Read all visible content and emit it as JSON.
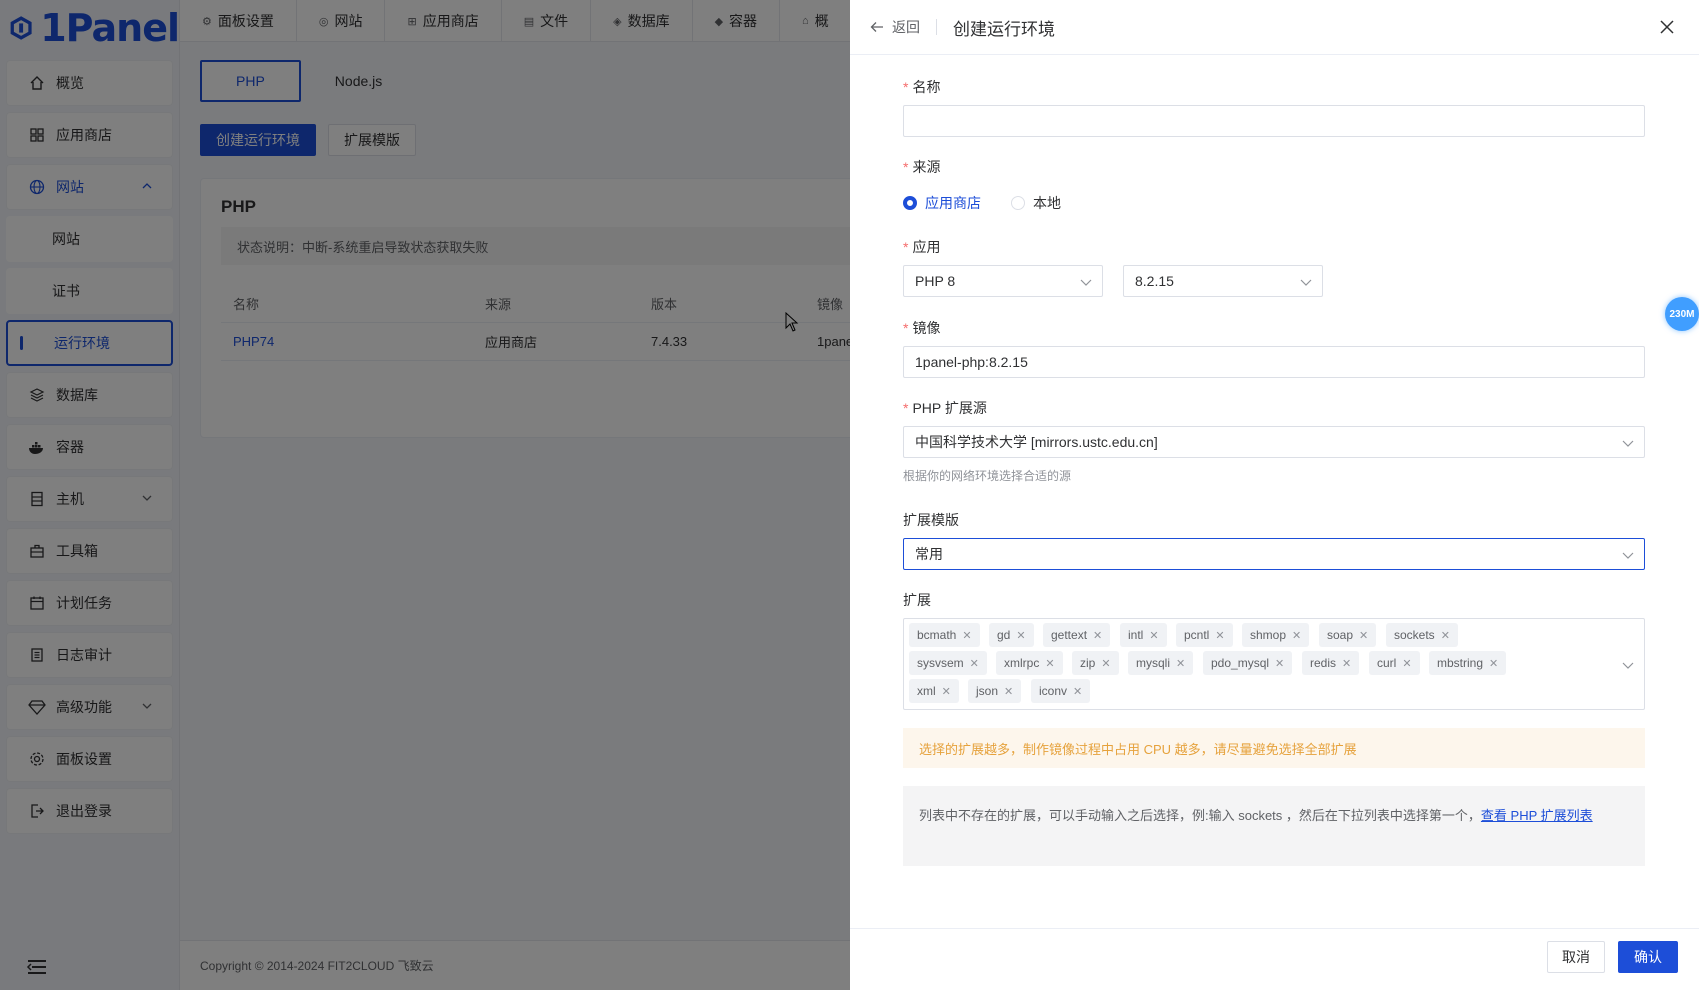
{
  "sidebar": {
    "logo_text": "1Panel",
    "items": [
      {
        "label": "概览",
        "icon": "home-icon"
      },
      {
        "label": "应用商店",
        "icon": "grid-icon"
      },
      {
        "label": "网站",
        "icon": "globe-icon"
      },
      {
        "label": "网站",
        "icon": ""
      },
      {
        "label": "证书",
        "icon": ""
      },
      {
        "label": "运行环境",
        "icon": ""
      },
      {
        "label": "数据库",
        "icon": "layers-icon"
      },
      {
        "label": "容器",
        "icon": "docker-icon"
      },
      {
        "label": "主机",
        "icon": "server-icon"
      },
      {
        "label": "工具箱",
        "icon": "toolbox-icon"
      },
      {
        "label": "计划任务",
        "icon": "calendar-icon"
      },
      {
        "label": "日志审计",
        "icon": "log-icon"
      },
      {
        "label": "高级功能",
        "icon": "diamond-icon"
      },
      {
        "label": "面板设置",
        "icon": "gear-icon"
      },
      {
        "label": "退出登录",
        "icon": "logout-icon"
      }
    ]
  },
  "topbar": {
    "tabs": [
      {
        "label": "面板设置",
        "glyph": "⚙"
      },
      {
        "label": "网站",
        "glyph": "◎"
      },
      {
        "label": "应用商店",
        "glyph": "⊞"
      },
      {
        "label": "文件",
        "glyph": "▤"
      },
      {
        "label": "数据库",
        "glyph": "◈"
      },
      {
        "label": "容器",
        "glyph": "◆"
      },
      {
        "label": "概",
        "glyph": "⌂"
      }
    ]
  },
  "main": {
    "subtabs": [
      "PHP",
      "Node.js"
    ],
    "buttons": {
      "create": "创建运行环境",
      "ext_template": "扩展模版"
    },
    "card_title": "PHP",
    "notice": "状态说明：中断-系统重启导致状态获取失败",
    "columns": [
      "名称",
      "来源",
      "版本",
      "镜像"
    ],
    "rows": [
      {
        "name": "PHP74",
        "source": "应用商店",
        "version": "7.4.33",
        "image": "1pane"
      }
    ],
    "footer": "Copyright © 2014-2024 FIT2CLOUD 飞致云"
  },
  "drawer": {
    "back_label": "返回",
    "title": "创建运行环境",
    "form": {
      "name_label": "名称",
      "name_value": "",
      "source_label": "来源",
      "source_options": [
        "应用商店",
        "本地"
      ],
      "app_label": "应用",
      "app_value": "PHP 8",
      "version_value": "8.2.15",
      "image_label": "镜像",
      "image_value": "1panel-php:8.2.15",
      "ext_source_label": "PHP 扩展源",
      "ext_source_value": "中国科学技术大学 [mirrors.ustc.edu.cn]",
      "ext_source_hint": "根据你的网络环境选择合适的源",
      "ext_template_label": "扩展模版",
      "ext_template_value": "常用",
      "extensions_label": "扩展",
      "extensions": [
        "bcmath",
        "gd",
        "gettext",
        "intl",
        "pcntl",
        "shmop",
        "soap",
        "sockets",
        "sysvsem",
        "xmlrpc",
        "zip",
        "mysqli",
        "pdo_mysql",
        "redis",
        "curl",
        "mbstring",
        "xml",
        "json",
        "iconv"
      ],
      "warning": "选择的扩展越多，制作镜像过程中占用 CPU 越多，请尽量避免选择全部扩展",
      "info_text": "列表中不存在的扩展，可以手动输入之后选择，例:输入 sockets ，然后在下拉列表中选择第一个，",
      "info_link": "查看 PHP 扩展列表"
    },
    "cancel_label": "取消",
    "confirm_label": "确认"
  },
  "float_badge": "230M",
  "colors": {
    "primary": "#1d4ed8",
    "danger": "#f56c6c",
    "warning": "#e6a23c"
  }
}
